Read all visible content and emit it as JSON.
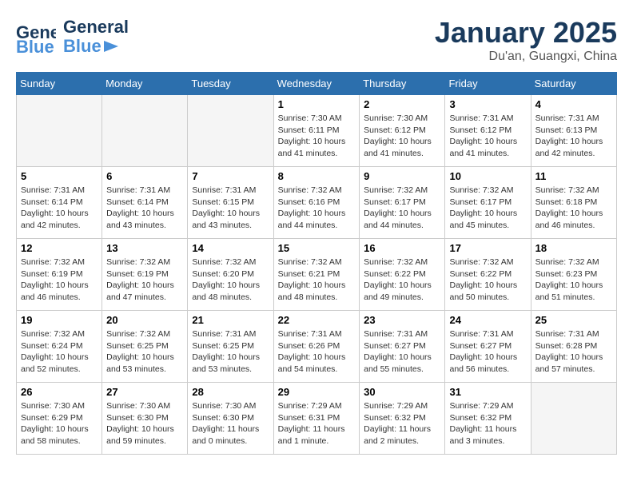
{
  "header": {
    "logo_general": "General",
    "logo_blue": "Blue",
    "month": "January 2025",
    "location": "Du'an, Guangxi, China"
  },
  "weekdays": [
    "Sunday",
    "Monday",
    "Tuesday",
    "Wednesday",
    "Thursday",
    "Friday",
    "Saturday"
  ],
  "weeks": [
    [
      {
        "day": "",
        "info": ""
      },
      {
        "day": "",
        "info": ""
      },
      {
        "day": "",
        "info": ""
      },
      {
        "day": "1",
        "info": "Sunrise: 7:30 AM\nSunset: 6:11 PM\nDaylight: 10 hours\nand 41 minutes."
      },
      {
        "day": "2",
        "info": "Sunrise: 7:30 AM\nSunset: 6:12 PM\nDaylight: 10 hours\nand 41 minutes."
      },
      {
        "day": "3",
        "info": "Sunrise: 7:31 AM\nSunset: 6:12 PM\nDaylight: 10 hours\nand 41 minutes."
      },
      {
        "day": "4",
        "info": "Sunrise: 7:31 AM\nSunset: 6:13 PM\nDaylight: 10 hours\nand 42 minutes."
      }
    ],
    [
      {
        "day": "5",
        "info": "Sunrise: 7:31 AM\nSunset: 6:14 PM\nDaylight: 10 hours\nand 42 minutes."
      },
      {
        "day": "6",
        "info": "Sunrise: 7:31 AM\nSunset: 6:14 PM\nDaylight: 10 hours\nand 43 minutes."
      },
      {
        "day": "7",
        "info": "Sunrise: 7:31 AM\nSunset: 6:15 PM\nDaylight: 10 hours\nand 43 minutes."
      },
      {
        "day": "8",
        "info": "Sunrise: 7:32 AM\nSunset: 6:16 PM\nDaylight: 10 hours\nand 44 minutes."
      },
      {
        "day": "9",
        "info": "Sunrise: 7:32 AM\nSunset: 6:17 PM\nDaylight: 10 hours\nand 44 minutes."
      },
      {
        "day": "10",
        "info": "Sunrise: 7:32 AM\nSunset: 6:17 PM\nDaylight: 10 hours\nand 45 minutes."
      },
      {
        "day": "11",
        "info": "Sunrise: 7:32 AM\nSunset: 6:18 PM\nDaylight: 10 hours\nand 46 minutes."
      }
    ],
    [
      {
        "day": "12",
        "info": "Sunrise: 7:32 AM\nSunset: 6:19 PM\nDaylight: 10 hours\nand 46 minutes."
      },
      {
        "day": "13",
        "info": "Sunrise: 7:32 AM\nSunset: 6:19 PM\nDaylight: 10 hours\nand 47 minutes."
      },
      {
        "day": "14",
        "info": "Sunrise: 7:32 AM\nSunset: 6:20 PM\nDaylight: 10 hours\nand 48 minutes."
      },
      {
        "day": "15",
        "info": "Sunrise: 7:32 AM\nSunset: 6:21 PM\nDaylight: 10 hours\nand 48 minutes."
      },
      {
        "day": "16",
        "info": "Sunrise: 7:32 AM\nSunset: 6:22 PM\nDaylight: 10 hours\nand 49 minutes."
      },
      {
        "day": "17",
        "info": "Sunrise: 7:32 AM\nSunset: 6:22 PM\nDaylight: 10 hours\nand 50 minutes."
      },
      {
        "day": "18",
        "info": "Sunrise: 7:32 AM\nSunset: 6:23 PM\nDaylight: 10 hours\nand 51 minutes."
      }
    ],
    [
      {
        "day": "19",
        "info": "Sunrise: 7:32 AM\nSunset: 6:24 PM\nDaylight: 10 hours\nand 52 minutes."
      },
      {
        "day": "20",
        "info": "Sunrise: 7:32 AM\nSunset: 6:25 PM\nDaylight: 10 hours\nand 53 minutes."
      },
      {
        "day": "21",
        "info": "Sunrise: 7:31 AM\nSunset: 6:25 PM\nDaylight: 10 hours\nand 53 minutes."
      },
      {
        "day": "22",
        "info": "Sunrise: 7:31 AM\nSunset: 6:26 PM\nDaylight: 10 hours\nand 54 minutes."
      },
      {
        "day": "23",
        "info": "Sunrise: 7:31 AM\nSunset: 6:27 PM\nDaylight: 10 hours\nand 55 minutes."
      },
      {
        "day": "24",
        "info": "Sunrise: 7:31 AM\nSunset: 6:27 PM\nDaylight: 10 hours\nand 56 minutes."
      },
      {
        "day": "25",
        "info": "Sunrise: 7:31 AM\nSunset: 6:28 PM\nDaylight: 10 hours\nand 57 minutes."
      }
    ],
    [
      {
        "day": "26",
        "info": "Sunrise: 7:30 AM\nSunset: 6:29 PM\nDaylight: 10 hours\nand 58 minutes."
      },
      {
        "day": "27",
        "info": "Sunrise: 7:30 AM\nSunset: 6:30 PM\nDaylight: 10 hours\nand 59 minutes."
      },
      {
        "day": "28",
        "info": "Sunrise: 7:30 AM\nSunset: 6:30 PM\nDaylight: 11 hours\nand 0 minutes."
      },
      {
        "day": "29",
        "info": "Sunrise: 7:29 AM\nSunset: 6:31 PM\nDaylight: 11 hours\nand 1 minute."
      },
      {
        "day": "30",
        "info": "Sunrise: 7:29 AM\nSunset: 6:32 PM\nDaylight: 11 hours\nand 2 minutes."
      },
      {
        "day": "31",
        "info": "Sunrise: 7:29 AM\nSunset: 6:32 PM\nDaylight: 11 hours\nand 3 minutes."
      },
      {
        "day": "",
        "info": ""
      }
    ]
  ]
}
